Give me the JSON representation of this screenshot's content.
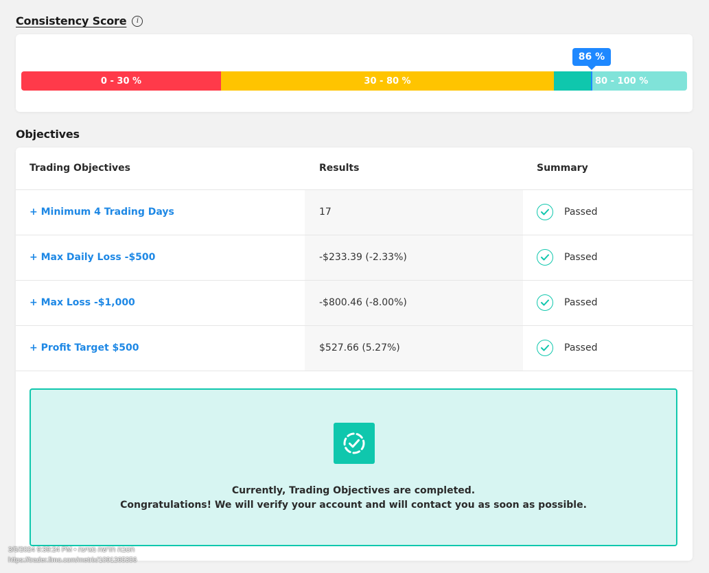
{
  "consistency": {
    "title": "Consistency Score",
    "info_icon": "info-icon",
    "score_label": "86 %",
    "score_value_percent": 86,
    "segments": [
      {
        "label": "0 - 30 %",
        "range": [
          0,
          30
        ],
        "color": "#ff3a4a"
      },
      {
        "label": "30 - 80 %",
        "range": [
          30,
          80
        ],
        "color": "#ffc400"
      },
      {
        "label": "80 - 100 %",
        "range": [
          80,
          100
        ],
        "color": "#80e3d9"
      }
    ],
    "marker_color": "#1e88ff",
    "filled_color": "#0fc7ad"
  },
  "objectives": {
    "title": "Objectives",
    "columns": [
      "Trading Objectives",
      "Results",
      "Summary"
    ],
    "rows": [
      {
        "objective": "+ Minimum 4 Trading Days",
        "result": "17",
        "summary": "Passed"
      },
      {
        "objective": "+ Max Daily Loss -$500",
        "result": "-$233.39 (-2.33%)",
        "summary": "Passed"
      },
      {
        "objective": "+ Max Loss -$1,000",
        "result": "-$800.46 (-8.00%)",
        "summary": "Passed"
      },
      {
        "objective": "+ Profit Target $500",
        "result": "$527.66 (5.27%)",
        "summary": "Passed"
      }
    ],
    "status_icon": "check-circle-icon",
    "link_color": "#1e88e5"
  },
  "completed": {
    "icon": "dashed-check-icon",
    "line1": "Currently, Trading Objectives are completed.",
    "line2": "Congratulations! We will verify your account and will contact you as soon as possible."
  },
  "watermark": {
    "line1": "3/5/2024 9:39:24 PM • הטבה חדשה מגיעה",
    "line2": "https://trader.fimo.com/metrix/1091265356"
  }
}
